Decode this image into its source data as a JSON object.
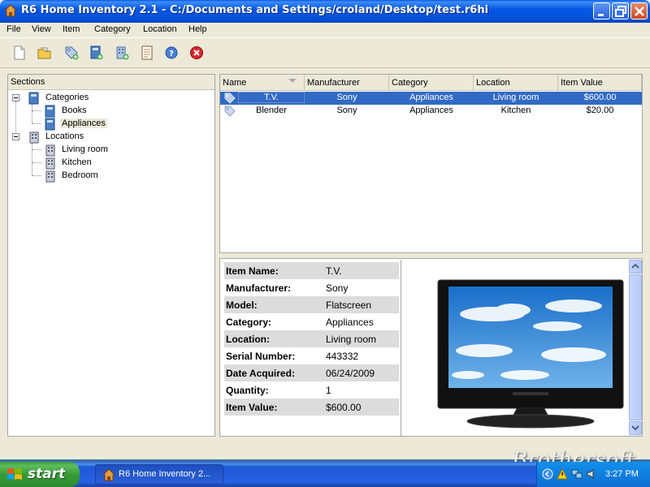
{
  "window": {
    "title": "R6 Home Inventory 2.1 - C:/Documents and Settings/croland/Desktop/test.r6hi"
  },
  "menu": [
    "File",
    "View",
    "Item",
    "Category",
    "Location",
    "Help"
  ],
  "toolbar": {
    "icons": [
      "new-icon",
      "open-icon",
      "tag-icon",
      "book-icon",
      "building-icon",
      "report-icon",
      "help-icon",
      "close-icon"
    ]
  },
  "sections": {
    "header": "Sections",
    "categories_label": "Categories",
    "categories": [
      "Books",
      "Appliances"
    ],
    "locations_label": "Locations",
    "locations": [
      "Living room",
      "Kitchen",
      "Bedroom"
    ]
  },
  "list": {
    "columns": [
      "Name",
      "Manufacturer",
      "Category",
      "Location",
      "Item Value"
    ],
    "rows": [
      {
        "name": "T.V.",
        "manufacturer": "Sony",
        "category": "Appliances",
        "location": "Living room",
        "value": "$600.00"
      },
      {
        "name": "Blender",
        "manufacturer": "Sony",
        "category": "Appliances",
        "location": "Kitchen",
        "value": "$20.00"
      }
    ]
  },
  "details": [
    {
      "label": "Item Name:",
      "value": "T.V."
    },
    {
      "label": "Manufacturer:",
      "value": "Sony"
    },
    {
      "label": "Model:",
      "value": "Flatscreen"
    },
    {
      "label": "Category:",
      "value": "Appliances"
    },
    {
      "label": "Location:",
      "value": "Living room"
    },
    {
      "label": "Serial Number:",
      "value": "443332"
    },
    {
      "label": "Date Acquired:",
      "value": "06/24/2009"
    },
    {
      "label": "Quantity:",
      "value": "1"
    },
    {
      "label": "Item Value:",
      "value": "$600.00"
    }
  ],
  "taskbar": {
    "start": "start",
    "task": "R6 Home Inventory 2...",
    "clock": "3:27 PM"
  },
  "watermark": "Brothersoft",
  "colors": {
    "title_blue": "#0450d8",
    "selection": "#316ac5",
    "face": "#ece9d8"
  }
}
